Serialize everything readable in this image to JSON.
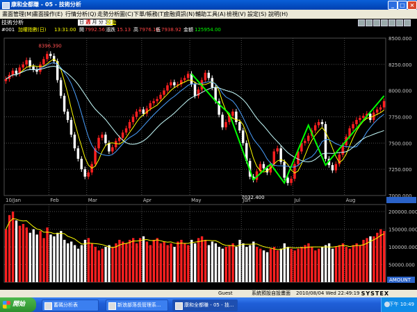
{
  "window": {
    "title": "康和全都賺 - 05 - 技術分析"
  },
  "menu": {
    "items": [
      "畫面管理(M)",
      "畫面操作(E)",
      "行情分析(Q)",
      "走勢分析圖(C)",
      "下單/帳務(T)",
      "金融資訊(N)",
      "輔助工具(A)",
      "檢視(V)",
      "設定(S)",
      "說明(H)"
    ]
  },
  "toolbar": {
    "title": "技術分析",
    "period_label": "日",
    "period_selected": "週",
    "period_month": "月",
    "period_other": "分",
    "period_value": "30",
    "link_label": "連動"
  },
  "info": {
    "code": "#001",
    "name": "加權指數(日)",
    "time": "13:31:00",
    "open_label": "開",
    "open_value": "7992.56",
    "change_label": "漲跌",
    "change_value": "15.13",
    "high_label": "高",
    "high_value": "7976.18",
    "low_label": "低",
    "low_value": "7938.92",
    "volume_label": "金額",
    "volume_value": "125954.00"
  },
  "colors": {
    "up": "#ff2020",
    "down": "#ffffff",
    "ma5": "#ffff00",
    "ma10": "#4aa0ff",
    "ma20": "#c8ffff",
    "pattern": "#00ff00",
    "grid": "#505050",
    "axis_text": "#c8c8c8",
    "annot": "#ff5050"
  },
  "chart_data": [
    {
      "type": "candlestick",
      "ylim": [
        7000,
        8500
      ],
      "y_ticks": [
        "8500.000",
        "8250.000",
        "8000.000",
        "7750.000",
        "7500.000",
        "7250.000",
        "7000.000"
      ],
      "x_ticks": [
        "10/Jan",
        "Feb",
        "Mar",
        "Apr",
        "May",
        "Jun",
        "Jul",
        "Aug"
      ],
      "annotations": [
        {
          "label": "8396.390",
          "value": 8396.39
        },
        {
          "label": "7032.400",
          "value": 7032.4
        }
      ],
      "series_close": [
        8110,
        8150,
        8190,
        8160,
        8220,
        8250,
        8290,
        8230,
        8200,
        8180,
        8250,
        8300,
        8350,
        8330,
        8280,
        8100,
        7950,
        7800,
        7720,
        7580,
        7450,
        7350,
        7250,
        7180,
        7220,
        7300,
        7450,
        7550,
        7580,
        7500,
        7420,
        7460,
        7520,
        7550,
        7600,
        7640,
        7700,
        7750,
        7800,
        7820,
        7780,
        7830,
        7880,
        7900,
        7920,
        7960,
        8000,
        8050,
        8080,
        8050,
        8060,
        8100,
        8120,
        8160,
        8060,
        7950,
        8010,
        8100,
        8170,
        8120,
        8030,
        7900,
        7770,
        7650,
        7700,
        7760,
        7800,
        7700,
        7620,
        7500,
        7330,
        7180,
        7150,
        7230,
        7300,
        7260,
        7220,
        7300,
        7420,
        7450,
        7320,
        7170,
        7120,
        7160,
        7300,
        7420,
        7500,
        7520,
        7570,
        7620,
        7670,
        7700,
        7680,
        7350,
        7290,
        7240,
        7300,
        7390,
        7480,
        7560,
        7640,
        7680,
        7720,
        7740,
        7760,
        7780,
        7720,
        7790,
        7820,
        7840,
        7900
      ]
    },
    {
      "type": "bar",
      "title": "AMOUNT",
      "ylim": [
        0,
        220000
      ],
      "y_ticks": [
        "200000.000",
        "150000.000",
        "100000.000",
        "50000.000"
      ],
      "volume": [
        150000,
        190000,
        200000,
        175000,
        160000,
        165000,
        155000,
        140000,
        150000,
        135000,
        145000,
        125000,
        155000,
        135000,
        130000,
        140000,
        145000,
        120000,
        110000,
        115000,
        105000,
        95000,
        105000,
        120000,
        125000,
        110000,
        100000,
        90000,
        95000,
        100000,
        105000,
        100000,
        110000,
        120000,
        115000,
        110000,
        120000,
        125000,
        110000,
        125000,
        130000,
        115000,
        105000,
        120000,
        125000,
        110000,
        115000,
        105000,
        110000,
        100000,
        115000,
        120000,
        110000,
        105000,
        120000,
        110000,
        125000,
        130000,
        120000,
        105000,
        115000,
        110000,
        100000,
        95000,
        100000,
        105000,
        110000,
        100000,
        120000,
        110000,
        100000,
        105000,
        115000,
        100000,
        95000,
        90000,
        85000,
        95000,
        100000,
        90000,
        95000,
        110000,
        100000,
        95000,
        90000,
        95000,
        100000,
        105000,
        110000,
        100000,
        90000,
        95000,
        100000,
        105000,
        110000,
        95000,
        100000,
        105000,
        110000,
        100000,
        95000,
        105000,
        110000,
        105000,
        120000,
        125000,
        130000,
        130000,
        140000,
        150000,
        145000
      ]
    }
  ],
  "status": {
    "user": "Guest",
    "message": "系統預設自設畫面",
    "datetime": "2010/08/04 Wed 22:49:19",
    "brand": "SYSTEX"
  },
  "taskbar": {
    "start_label": "開始",
    "tasks": [
      "蓄碼分析表",
      "新浪部落長管理系...",
      "康和全都賺 - 05 - 技..."
    ],
    "clock": "下午 10:49"
  }
}
